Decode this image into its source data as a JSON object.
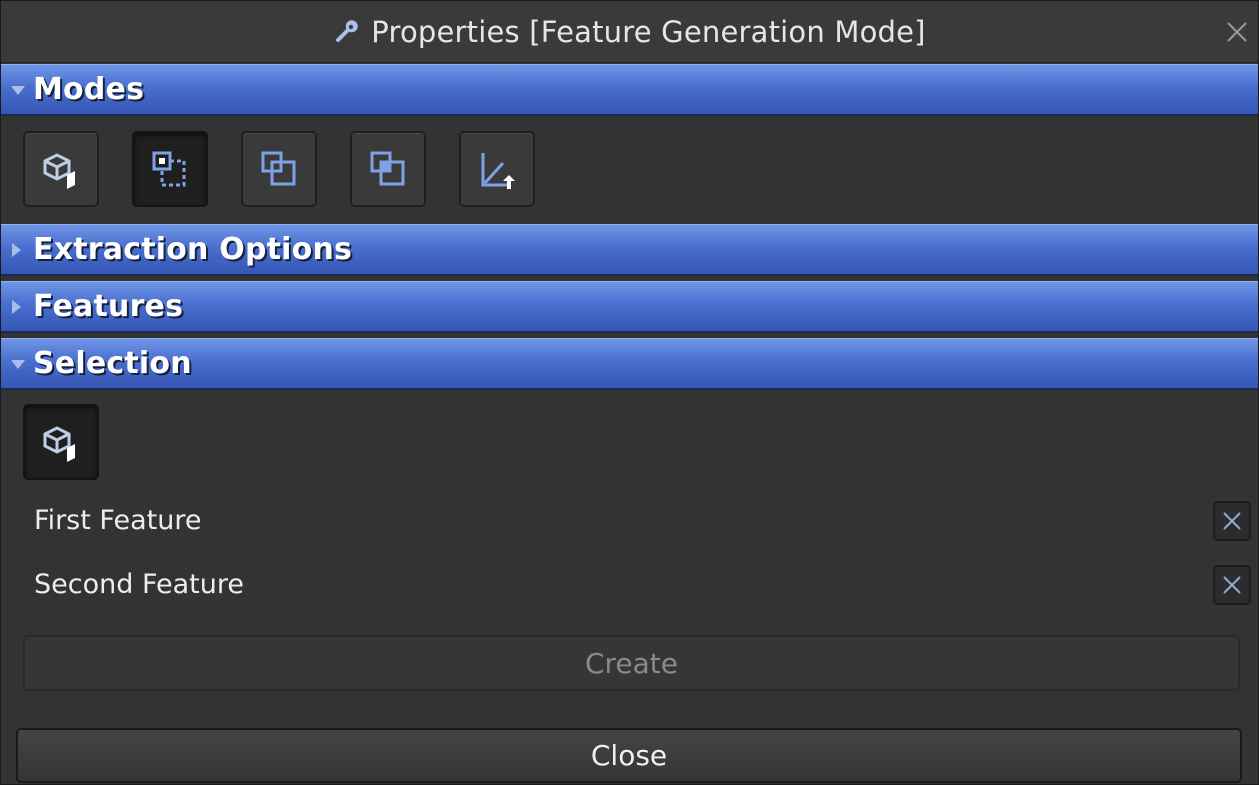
{
  "window": {
    "title": "Properties [Feature Generation Mode]",
    "title_icon": "wrench-icon",
    "close_icon": "close-icon"
  },
  "sections": {
    "modes": {
      "label": "Modes",
      "expanded": true,
      "tools": [
        {
          "name": "select-object-tool",
          "icon": "cube-cursor-icon",
          "active": false
        },
        {
          "name": "feature-from-selection-tool",
          "icon": "selection-rect-icon",
          "active": true
        },
        {
          "name": "overlap-features-tool",
          "icon": "overlap-squares-icon",
          "active": false
        },
        {
          "name": "intersect-features-tool",
          "icon": "intersect-squares-icon",
          "active": false
        },
        {
          "name": "axis-feature-tool",
          "icon": "axis-up-icon",
          "active": false
        }
      ]
    },
    "extraction_options": {
      "label": "Extraction Options",
      "expanded": false
    },
    "features": {
      "label": "Features",
      "expanded": false
    },
    "selection": {
      "label": "Selection",
      "expanded": true,
      "tool": {
        "name": "select-object-tool",
        "icon": "cube-cursor-icon"
      },
      "items": [
        {
          "label": "First Feature",
          "remove_icon": "close-icon"
        },
        {
          "label": "Second Feature",
          "remove_icon": "close-icon"
        }
      ],
      "create_label": "Create"
    }
  },
  "footer": {
    "close_label": "Close"
  },
  "colors": {
    "header_blue": "#4a6fcf",
    "panel_bg": "#333333",
    "icon_blue": "#7ea2e6"
  }
}
